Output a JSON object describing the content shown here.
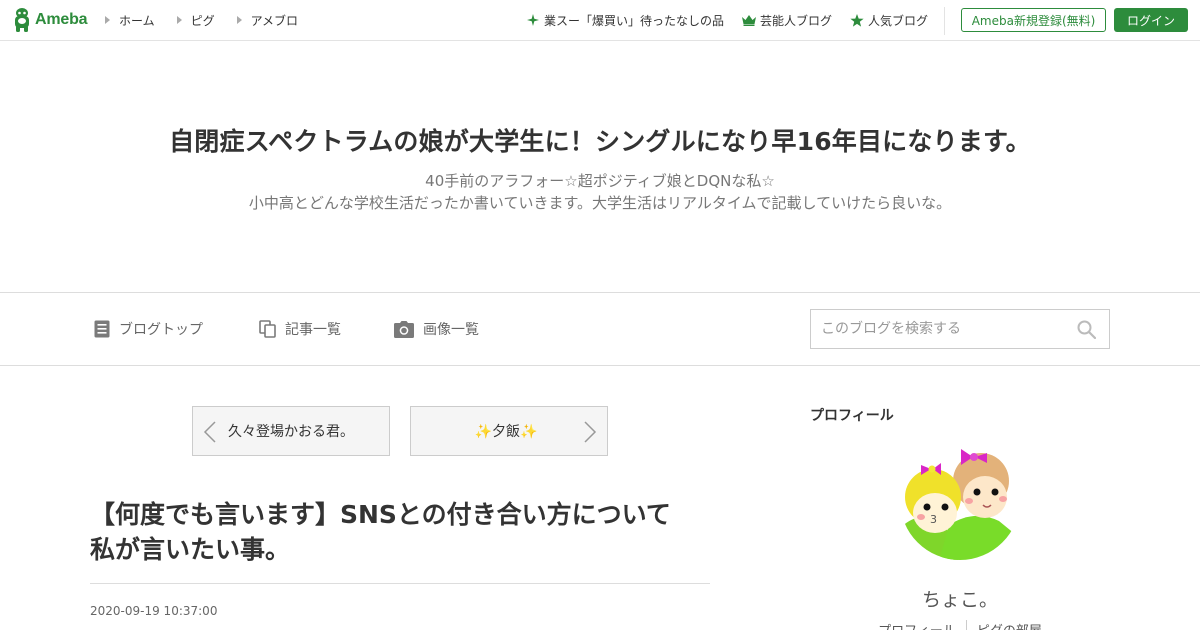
{
  "header": {
    "logo_text": "Ameba",
    "nav": [
      {
        "label": "ホーム"
      },
      {
        "label": "ピグ"
      },
      {
        "label": "アメブロ"
      }
    ],
    "promo_items": [
      {
        "label": "業スー「爆買い」待ったなしの品",
        "icon": "sparkle-icon"
      },
      {
        "label": "芸能人ブログ",
        "icon": "crown-icon"
      },
      {
        "label": "人気ブログ",
        "icon": "star-icon"
      }
    ],
    "register_label": "Ameba新規登録(無料)",
    "login_label": "ログイン"
  },
  "blog": {
    "title": "自閉症スペクトラムの娘が大学生に！シングルになり早16年目になります。",
    "description_line1": "40手前のアラフォー☆超ポジティブ娘とDQNな私☆",
    "description_line2": "小中高とどんな学校生活だったか書いていきます。大学生活はリアルタイムで記載していけたら良いな。"
  },
  "blog_nav": {
    "items": [
      {
        "label": "ブログトップ",
        "icon": "document-icon"
      },
      {
        "label": "記事一覧",
        "icon": "copy-icon"
      },
      {
        "label": "画像一覧",
        "icon": "camera-icon"
      }
    ],
    "search_placeholder": "このブログを検索する"
  },
  "article_nav": {
    "prev_label": "久々登場かおる君。",
    "next_label": "✨夕飯✨"
  },
  "article": {
    "title_line1": "【何度でも言います】SNSとの付き合い方について",
    "title_line2": "私が言いたい事。",
    "date": "2020-09-19 10:37:00"
  },
  "sidebar": {
    "heading": "プロフィール",
    "nickname": "ちょこ。",
    "links": [
      {
        "label": "プロフィール"
      },
      {
        "label": "ピグの部屋"
      }
    ]
  },
  "colors": {
    "brand_green": "#2d8c3c",
    "text": "#333333",
    "muted": "#777777"
  }
}
